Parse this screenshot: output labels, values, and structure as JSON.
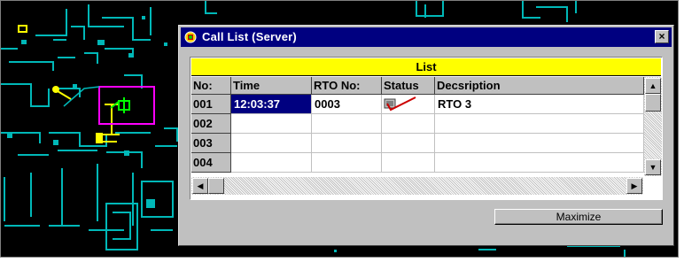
{
  "window": {
    "title": "Call List (Server)",
    "close_symbol": "×",
    "icon": "network-icon"
  },
  "grid": {
    "caption": "List",
    "columns": [
      "No:",
      "Time",
      "RTO No:",
      "Status",
      "Decsription"
    ],
    "rows": [
      {
        "no": "001",
        "time": "12:03:37",
        "rto": "0003",
        "status": "check-mark-icon",
        "description": "RTO 3",
        "selected_cell": "time"
      },
      {
        "no": "002",
        "time": "",
        "rto": "",
        "status": "",
        "description": ""
      },
      {
        "no": "003",
        "time": "",
        "rto": "",
        "status": "",
        "description": ""
      },
      {
        "no": "004",
        "time": "",
        "rto": "",
        "status": "",
        "description": ""
      }
    ]
  },
  "buttons": {
    "maximize_label": "Maximize"
  },
  "colors": {
    "titlebar": "#000080",
    "caption_bar": "#ffff00",
    "selection": "#000080",
    "map_background": "#000000",
    "map_walls": "#00c0c0",
    "map_highlight": "#ff00ff",
    "status_mark": "#cc0000"
  }
}
